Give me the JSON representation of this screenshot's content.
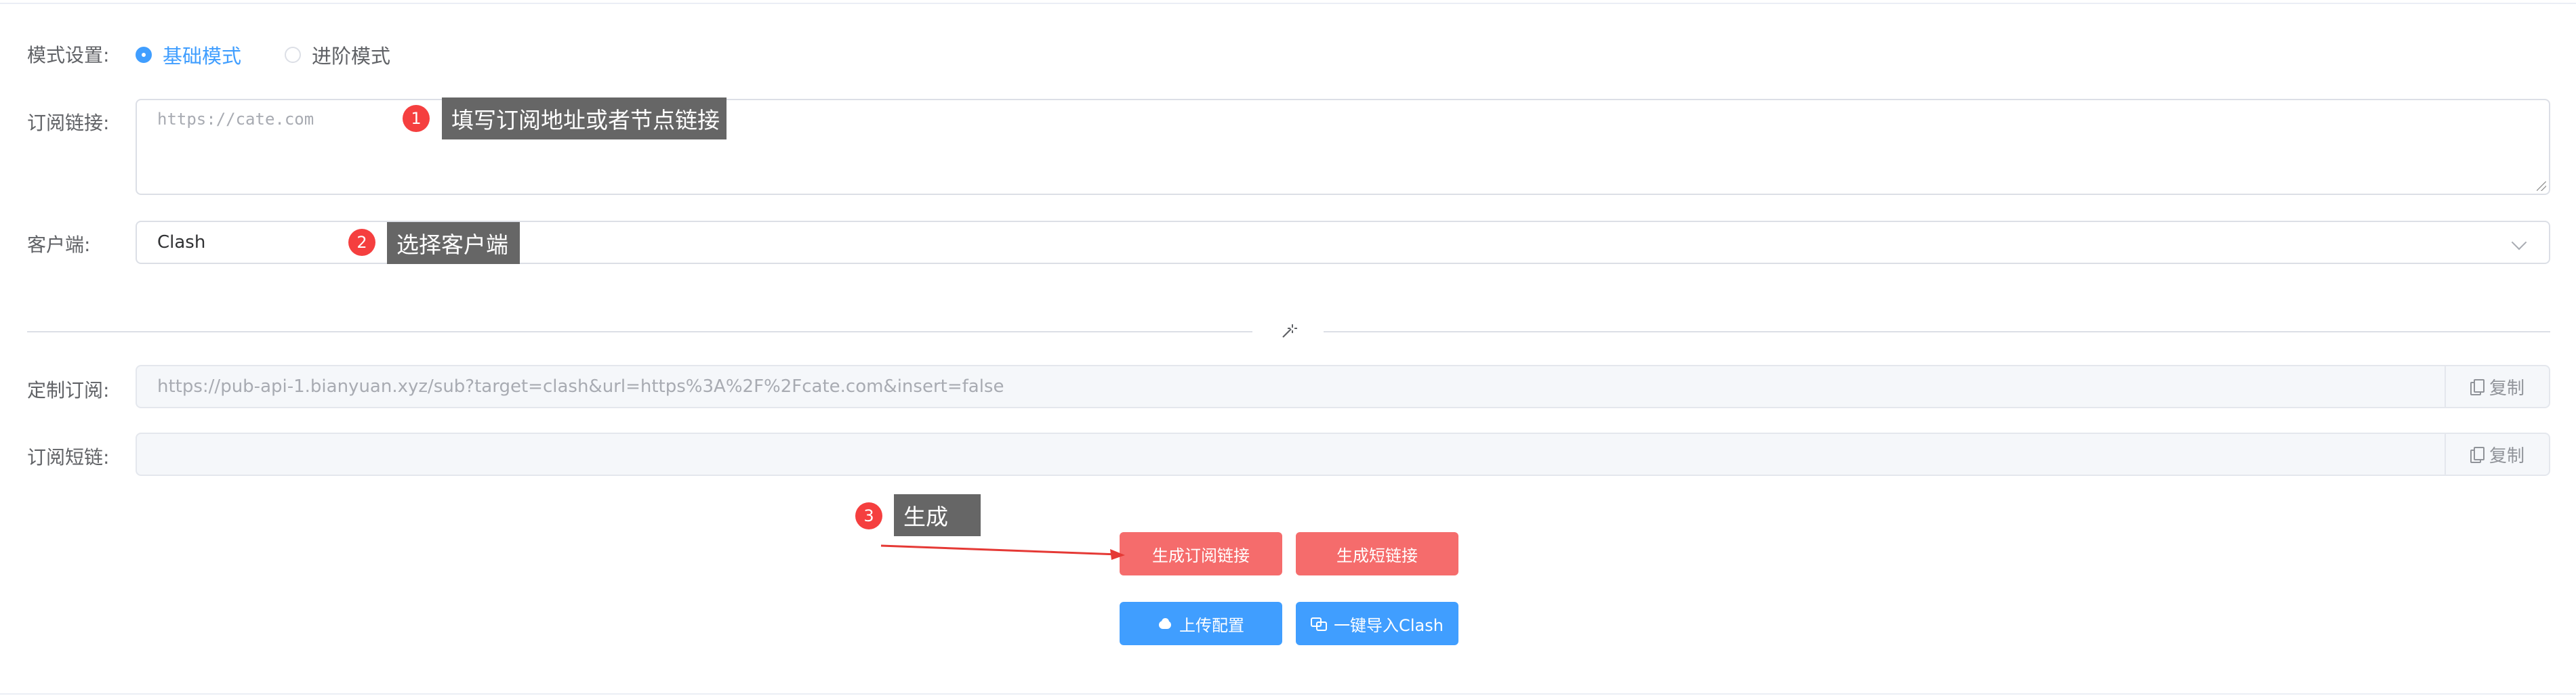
{
  "mode": {
    "label": "模式设置:",
    "options": [
      {
        "label": "基础模式",
        "selected": true
      },
      {
        "label": "进阶模式",
        "selected": false
      }
    ]
  },
  "subscription": {
    "label": "订阅链接:",
    "placeholder": "https://cate.com",
    "value": ""
  },
  "client": {
    "label": "客户端:",
    "selected": "Clash"
  },
  "divider": {
    "icon": "magic-wand-icon"
  },
  "custom_sub": {
    "label": "定制订阅:",
    "value": "https://pub-api-1.bianyuan.xyz/sub?target=clash&url=https%3A%2F%2Fcate.com&insert=false",
    "copy_label": "复制"
  },
  "short_link": {
    "label": "订阅短链:",
    "value": "",
    "copy_label": "复制"
  },
  "buttons": {
    "generate_sub": "生成订阅链接",
    "generate_short": "生成短链接",
    "upload_config": "上传配置",
    "import_clash": "一键导入Clash"
  },
  "annotations": [
    {
      "number": "1",
      "text": "填写订阅地址或者节点链接"
    },
    {
      "number": "2",
      "text": "选择客户端"
    },
    {
      "number": "3",
      "text": "生成"
    }
  ],
  "colors": {
    "primary": "#409eff",
    "danger": "#f56c6c",
    "badge": "#f53f3f",
    "callout_bg": "#666666"
  }
}
